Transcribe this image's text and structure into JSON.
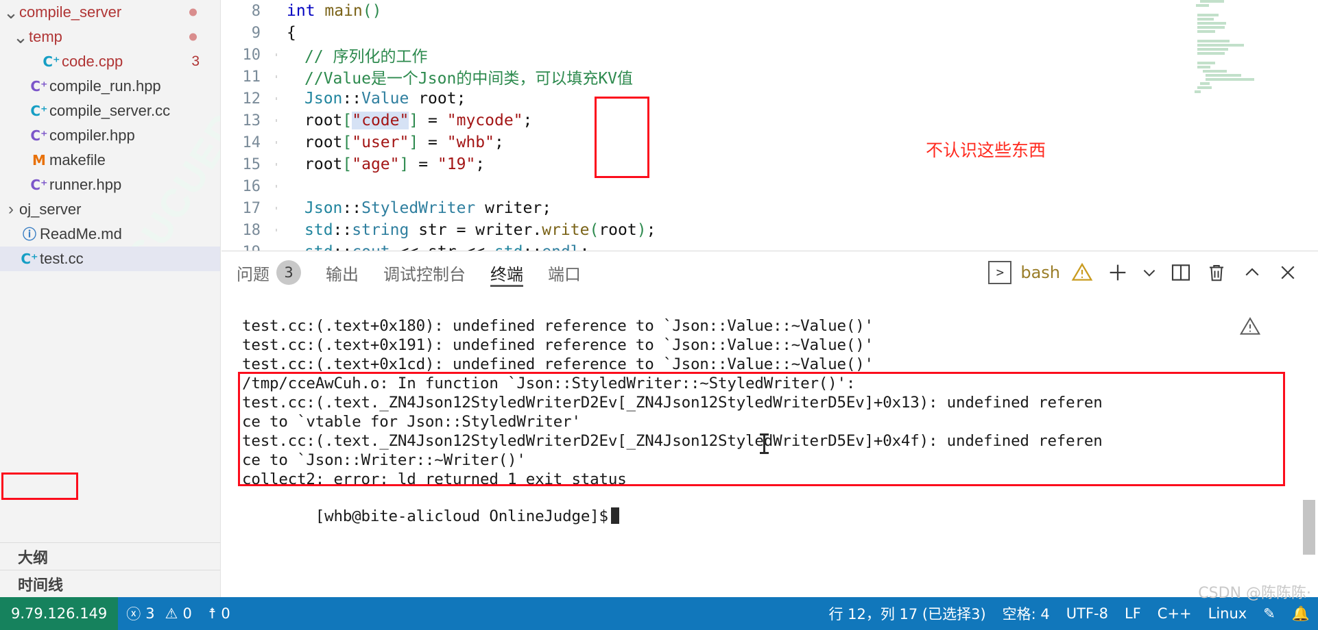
{
  "sidebar": {
    "tree": [
      {
        "label": "compile_server",
        "kind": "folder",
        "expanded": true,
        "indent": 0,
        "icon": "chevron-down-icon",
        "modified": true,
        "dot": true
      },
      {
        "label": "temp",
        "kind": "folder",
        "expanded": true,
        "indent": 1,
        "icon": "chevron-down-icon",
        "modified": true,
        "dot": true
      },
      {
        "label": "code.cpp",
        "kind": "file",
        "indent": 2,
        "icon": "cpp-file-icon",
        "modified": true,
        "count": "3"
      },
      {
        "label": "compile_run.hpp",
        "kind": "file",
        "indent": 1,
        "icon": "cpp-file-icon"
      },
      {
        "label": "compile_server.cc",
        "kind": "file",
        "indent": 1,
        "icon": "cpp-file-icon"
      },
      {
        "label": "compiler.hpp",
        "kind": "file",
        "indent": 1,
        "icon": "cpp-file-icon"
      },
      {
        "label": "makefile",
        "kind": "file",
        "indent": 1,
        "icon": "makefile-icon"
      },
      {
        "label": "runner.hpp",
        "kind": "file",
        "indent": 1,
        "icon": "cpp-file-icon"
      },
      {
        "label": "oj_server",
        "kind": "folder",
        "expanded": false,
        "indent": 0,
        "icon": "chevron-right-icon"
      },
      {
        "label": "ReadMe.md",
        "kind": "file",
        "indent": 0,
        "icon": "markdown-icon"
      },
      {
        "label": "test.cc",
        "kind": "file",
        "indent": 0,
        "icon": "cpp-file-icon",
        "selected": true
      }
    ],
    "sections": [
      {
        "label": "大纲"
      },
      {
        "label": "时间线"
      }
    ],
    "watermark": "CUCUEDLY"
  },
  "editor": {
    "lines": [
      {
        "num": "8",
        "guide": false,
        "tokens": [
          {
            "t": "int ",
            "c": "kw"
          },
          {
            "t": "main",
            "c": "fn"
          },
          {
            "t": "()",
            "c": "brk"
          }
        ]
      },
      {
        "num": "9",
        "guide": false,
        "tokens": [
          {
            "t": "{",
            "c": "plain"
          }
        ]
      },
      {
        "num": "10",
        "guide": true,
        "tokens": [
          {
            "t": "// 序列化的工作",
            "c": "cmt"
          }
        ]
      },
      {
        "num": "11",
        "guide": true,
        "tokens": [
          {
            "t": "//Value是一个Json的中间类，可以填充KV值",
            "c": "cmt"
          }
        ]
      },
      {
        "num": "12",
        "guide": true,
        "tokens": [
          {
            "t": "Json",
            "c": "ns"
          },
          {
            "t": "::",
            "c": "plain"
          },
          {
            "t": "Value",
            "c": "type"
          },
          {
            "t": " root;",
            "c": "plain"
          }
        ]
      },
      {
        "num": "13",
        "guide": true,
        "tokens": [
          {
            "t": "root",
            "c": "plain"
          },
          {
            "t": "[",
            "c": "brk"
          },
          {
            "t": "\"code\"",
            "c": "str sel"
          },
          {
            "t": "]",
            "c": "brk"
          },
          {
            "t": " = ",
            "c": "plain"
          },
          {
            "t": "\"mycode\"",
            "c": "str"
          },
          {
            "t": ";",
            "c": "plain"
          }
        ]
      },
      {
        "num": "14",
        "guide": true,
        "tokens": [
          {
            "t": "root",
            "c": "plain"
          },
          {
            "t": "[",
            "c": "brk"
          },
          {
            "t": "\"user\"",
            "c": "str"
          },
          {
            "t": "]",
            "c": "brk"
          },
          {
            "t": " = ",
            "c": "plain"
          },
          {
            "t": "\"whb\"",
            "c": "str"
          },
          {
            "t": ";",
            "c": "plain"
          }
        ]
      },
      {
        "num": "15",
        "guide": true,
        "tokens": [
          {
            "t": "root",
            "c": "plain"
          },
          {
            "t": "[",
            "c": "brk"
          },
          {
            "t": "\"age\"",
            "c": "str"
          },
          {
            "t": "]",
            "c": "brk"
          },
          {
            "t": " = ",
            "c": "plain"
          },
          {
            "t": "\"19\"",
            "c": "str"
          },
          {
            "t": ";",
            "c": "plain"
          }
        ]
      },
      {
        "num": "16",
        "guide": true,
        "tokens": []
      },
      {
        "num": "17",
        "guide": true,
        "tokens": [
          {
            "t": "Json",
            "c": "ns"
          },
          {
            "t": "::",
            "c": "plain"
          },
          {
            "t": "StyledWriter",
            "c": "type"
          },
          {
            "t": " writer;",
            "c": "plain"
          }
        ]
      },
      {
        "num": "18",
        "guide": true,
        "tokens": [
          {
            "t": "std",
            "c": "ns"
          },
          {
            "t": "::",
            "c": "plain"
          },
          {
            "t": "string",
            "c": "type"
          },
          {
            "t": " str = writer.",
            "c": "plain"
          },
          {
            "t": "write",
            "c": "fn"
          },
          {
            "t": "(",
            "c": "brk"
          },
          {
            "t": "root",
            "c": "plain"
          },
          {
            "t": ")",
            "c": "brk"
          },
          {
            "t": ";",
            "c": "plain"
          }
        ]
      },
      {
        "num": "19",
        "guide": true,
        "tokens": [
          {
            "t": "std",
            "c": "ns"
          },
          {
            "t": "::",
            "c": "plain"
          },
          {
            "t": "cout",
            "c": "type"
          },
          {
            "t": " << str << ",
            "c": "plain"
          },
          {
            "t": "std",
            "c": "ns"
          },
          {
            "t": "::",
            "c": "plain"
          },
          {
            "t": "endl",
            "c": "type"
          },
          {
            "t": ";",
            "c": "plain"
          }
        ]
      }
    ],
    "annotation": "不认识这些东西"
  },
  "panel": {
    "tabs": [
      {
        "label": "问题",
        "count": "3",
        "active": false
      },
      {
        "label": "输出",
        "count": "",
        "active": false
      },
      {
        "label": "调试控制台",
        "count": "",
        "active": false
      },
      {
        "label": "终端",
        "count": "",
        "active": true
      },
      {
        "label": "端口",
        "count": "",
        "active": false
      }
    ],
    "shell": "bash",
    "actions": [
      {
        "name": "terminal-select",
        "glyph": ">"
      },
      {
        "name": "warning-icon",
        "glyph": "warning"
      },
      {
        "name": "new-terminal",
        "glyph": "plus"
      },
      {
        "name": "terminal-dropdown",
        "glyph": "chevron-down"
      },
      {
        "name": "split-terminal",
        "glyph": "split"
      },
      {
        "name": "kill-terminal",
        "glyph": "trash"
      },
      {
        "name": "maximize-panel",
        "glyph": "chevron-up"
      },
      {
        "name": "close-panel",
        "glyph": "close"
      }
    ],
    "terminal_lines": [
      "test.cc:(.text+0x180): undefined reference to `Json::Value::~Value()'",
      "test.cc:(.text+0x191): undefined reference to `Json::Value::~Value()'",
      "test.cc:(.text+0x1cd): undefined reference to `Json::Value::~Value()'",
      "/tmp/cceAwCuh.o: In function `Json::StyledWriter::~StyledWriter()':",
      "test.cc:(.text._ZN4Json12StyledWriterD2Ev[_ZN4Json12StyledWriterD5Ev]+0x13): undefined referen",
      "ce to `vtable for Json::StyledWriter'",
      "test.cc:(.text._ZN4Json12StyledWriterD2Ev[_ZN4Json12StyledWriterD5Ev]+0x4f): undefined referen",
      "ce to `Json::Writer::~Writer()'",
      "collect2: error: ld returned 1 exit status"
    ],
    "prompt": "[whb@bite-alicloud OnlineJudge]$"
  },
  "statusbar": {
    "remote": "9.79.126.149",
    "left_items": [
      {
        "name": "errors",
        "icon": "error-icon",
        "value": "3"
      },
      {
        "name": "warnings",
        "icon": "warning-icon",
        "value": "0"
      },
      {
        "name": "radio-tower",
        "icon": "broadcast-icon",
        "value": "0"
      }
    ],
    "right_items": [
      {
        "name": "cursor-position",
        "label": "行 12，列 17 (已选择3)"
      },
      {
        "name": "indentation",
        "label": "空格: 4"
      },
      {
        "name": "encoding",
        "label": "UTF-8"
      },
      {
        "name": "eol",
        "label": "LF"
      },
      {
        "name": "language-mode",
        "label": "C++"
      },
      {
        "name": "platform",
        "label": "Linux"
      }
    ]
  },
  "watermark": "CSDN @陈陈陈·",
  "colors": {
    "accent": "#1177bb",
    "remote_green": "#16825d",
    "annotation_red": "#fc0d1c",
    "modified_file": "#b03535"
  }
}
